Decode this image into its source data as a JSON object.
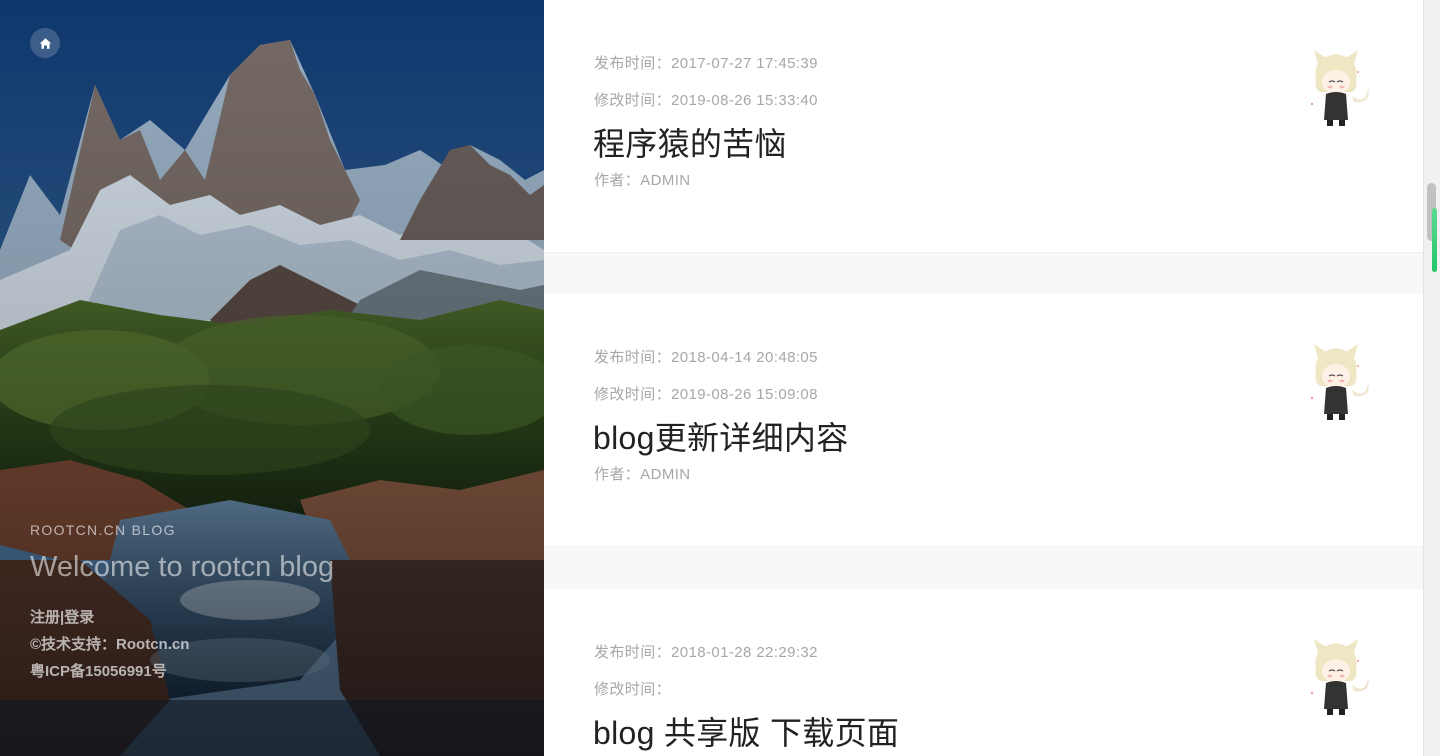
{
  "sidebar": {
    "blog_name": "ROOTCN.CN BLOG",
    "welcome": "Welcome to rootcn blog",
    "register_label": "注册",
    "separator": "|",
    "login_label": "登录",
    "tech_support": "©技术支持：Rootcn.cn",
    "icp": "粤ICP备15056991号",
    "home_icon": "home-icon"
  },
  "posts": [
    {
      "published": "发布时间：2017-07-27 17:45:39",
      "modified": "修改时间：2019-08-26 15:33:40",
      "title": "程序猿的苦恼",
      "author": "作者：ADMIN"
    },
    {
      "published": "发布时间：2018-04-14 20:48:05",
      "modified": "修改时间：2019-08-26 15:09:08",
      "title": "blog更新详细内容",
      "author": "作者：ADMIN"
    },
    {
      "published": "发布时间：2018-01-28 22:29:32",
      "modified": "修改时间：",
      "title": "blog 共享版 下载页面"
    }
  ],
  "colors": {
    "accent": "#2ecc71",
    "meta_text": "#a7a7a7",
    "title_text": "#222222"
  }
}
